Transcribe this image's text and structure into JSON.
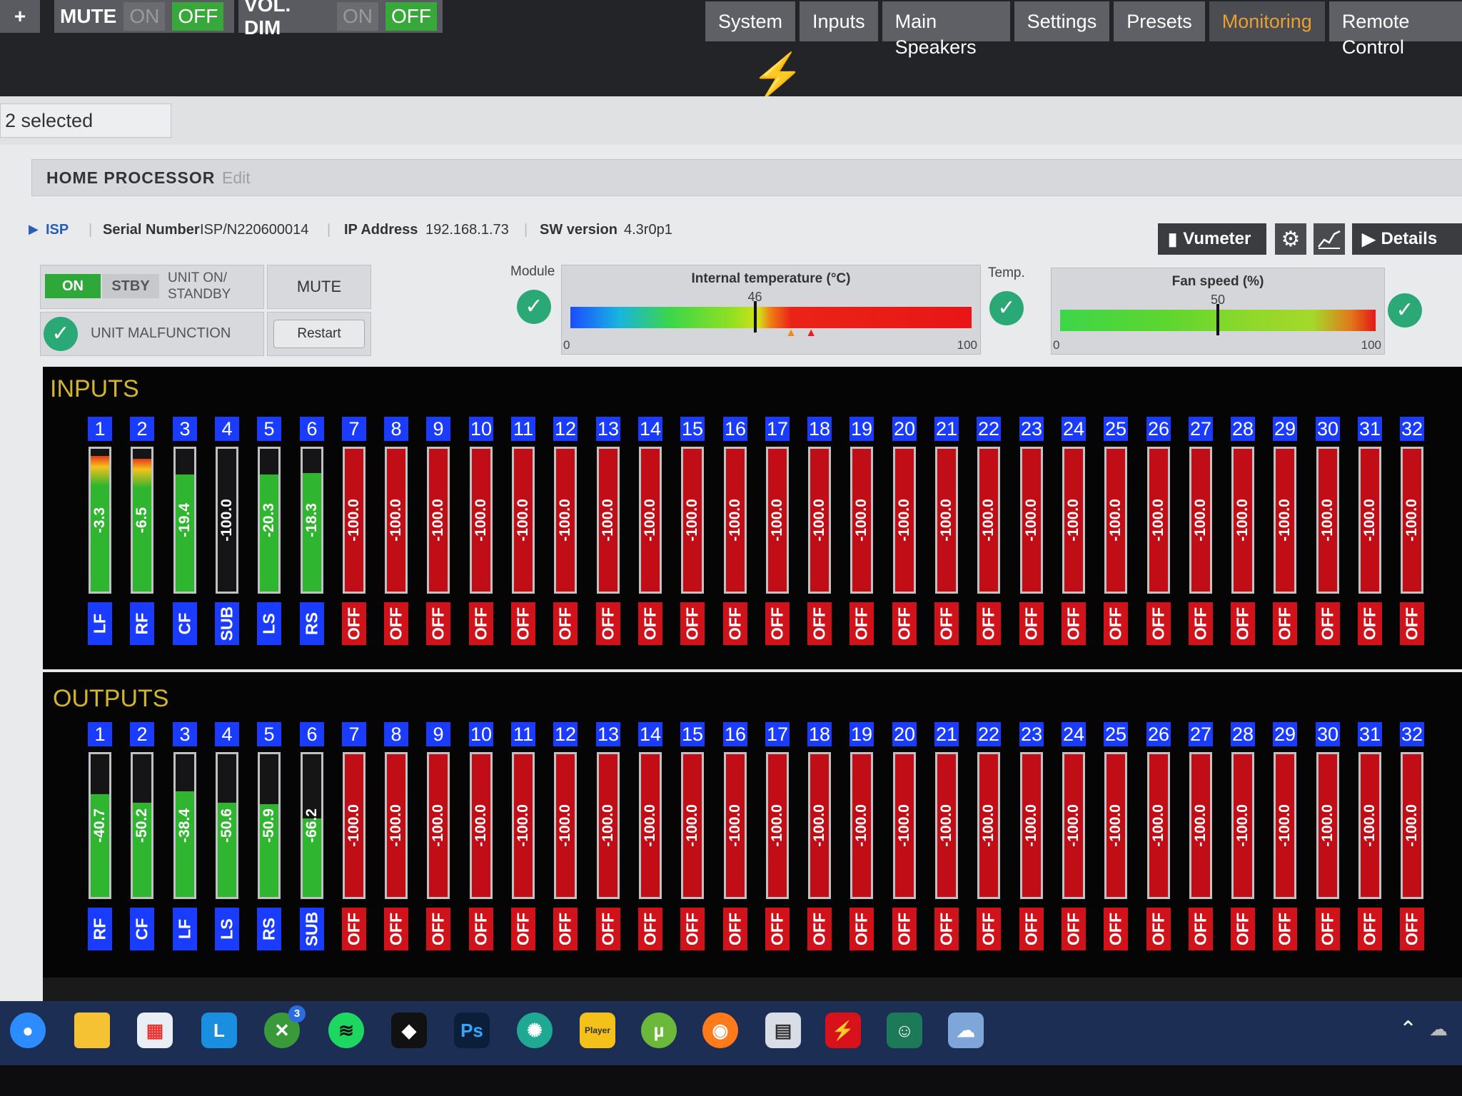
{
  "topbar": {
    "add_label": "+",
    "mute": {
      "label": "MUTE",
      "on": "ON",
      "off": "OFF"
    },
    "voldim": {
      "label": "VOL. DIM",
      "on": "ON",
      "off": "OFF"
    },
    "nav": [
      "System",
      "Inputs",
      "Main Speakers",
      "Settings",
      "Presets",
      "Monitoring",
      "Remote Control"
    ],
    "active_nav": "Monitoring"
  },
  "selected_text": "2 selected",
  "device": {
    "name": "HOME PROCESSOR",
    "edit": "Edit",
    "type": "ISP",
    "serial_label": "Serial Number",
    "serial": "ISP/N220600014",
    "ip_label": "IP Address",
    "ip": "192.168.1.73",
    "sw_label": "SW version",
    "sw": "4.3r0p1",
    "vumeter_label": "Vumeter",
    "details_label": "Details"
  },
  "controls": {
    "on": "ON",
    "stby": "STBY",
    "unit_on_standby": "UNIT ON/ STANDBY",
    "mute": "MUTE",
    "unit_malfunction": "UNIT MALFUNCTION",
    "restart": "Restart",
    "module_label": "Module",
    "temp_label": "Temp."
  },
  "temperature": {
    "title": "Internal temperature (°C)",
    "value": 46,
    "min": 0,
    "max": 100,
    "warn": 55,
    "crit": 60
  },
  "fan": {
    "title": "Fan speed (%)",
    "value": 50,
    "min": 0,
    "max": 100
  },
  "inputs": {
    "title": "INPUTS",
    "channels": [
      {
        "n": "1",
        "v": "-3.3",
        "lvl": 0.95,
        "c": "green",
        "tag": "LF",
        "tc": "blue"
      },
      {
        "n": "2",
        "v": "-6.5",
        "lvl": 0.93,
        "c": "green",
        "tag": "RF",
        "tc": "blue"
      },
      {
        "n": "3",
        "v": "-19.4",
        "lvl": 0.82,
        "c": "green",
        "tag": "CF",
        "tc": "blue"
      },
      {
        "n": "4",
        "v": "-100.0",
        "lvl": 0.0,
        "c": "gray",
        "tag": "SUB",
        "tc": "blue"
      },
      {
        "n": "5",
        "v": "-20.3",
        "lvl": 0.82,
        "c": "green",
        "tag": "LS",
        "tc": "blue"
      },
      {
        "n": "6",
        "v": "-18.3",
        "lvl": 0.83,
        "c": "green",
        "tag": "RS",
        "tc": "blue"
      },
      {
        "n": "7",
        "v": "-100.0",
        "lvl": 1,
        "c": "red",
        "tag": "OFF",
        "tc": "red"
      },
      {
        "n": "8",
        "v": "-100.0",
        "lvl": 1,
        "c": "red",
        "tag": "OFF",
        "tc": "red"
      },
      {
        "n": "9",
        "v": "-100.0",
        "lvl": 1,
        "c": "red",
        "tag": "OFF",
        "tc": "red"
      },
      {
        "n": "10",
        "v": "-100.0",
        "lvl": 1,
        "c": "red",
        "tag": "OFF",
        "tc": "red"
      },
      {
        "n": "11",
        "v": "-100.0",
        "lvl": 1,
        "c": "red",
        "tag": "OFF",
        "tc": "red"
      },
      {
        "n": "12",
        "v": "-100.0",
        "lvl": 1,
        "c": "red",
        "tag": "OFF",
        "tc": "red"
      },
      {
        "n": "13",
        "v": "-100.0",
        "lvl": 1,
        "c": "red",
        "tag": "OFF",
        "tc": "red"
      },
      {
        "n": "14",
        "v": "-100.0",
        "lvl": 1,
        "c": "red",
        "tag": "OFF",
        "tc": "red"
      },
      {
        "n": "15",
        "v": "-100.0",
        "lvl": 1,
        "c": "red",
        "tag": "OFF",
        "tc": "red"
      },
      {
        "n": "16",
        "v": "-100.0",
        "lvl": 1,
        "c": "red",
        "tag": "OFF",
        "tc": "red"
      },
      {
        "n": "17",
        "v": "-100.0",
        "lvl": 1,
        "c": "red",
        "tag": "OFF",
        "tc": "red"
      },
      {
        "n": "18",
        "v": "-100.0",
        "lvl": 1,
        "c": "red",
        "tag": "OFF",
        "tc": "red"
      },
      {
        "n": "19",
        "v": "-100.0",
        "lvl": 1,
        "c": "red",
        "tag": "OFF",
        "tc": "red"
      },
      {
        "n": "20",
        "v": "-100.0",
        "lvl": 1,
        "c": "red",
        "tag": "OFF",
        "tc": "red"
      },
      {
        "n": "21",
        "v": "-100.0",
        "lvl": 1,
        "c": "red",
        "tag": "OFF",
        "tc": "red"
      },
      {
        "n": "22",
        "v": "-100.0",
        "lvl": 1,
        "c": "red",
        "tag": "OFF",
        "tc": "red"
      },
      {
        "n": "23",
        "v": "-100.0",
        "lvl": 1,
        "c": "red",
        "tag": "OFF",
        "tc": "red"
      },
      {
        "n": "24",
        "v": "-100.0",
        "lvl": 1,
        "c": "red",
        "tag": "OFF",
        "tc": "red"
      },
      {
        "n": "25",
        "v": "-100.0",
        "lvl": 1,
        "c": "red",
        "tag": "OFF",
        "tc": "red"
      },
      {
        "n": "26",
        "v": "-100.0",
        "lvl": 1,
        "c": "red",
        "tag": "OFF",
        "tc": "red"
      },
      {
        "n": "27",
        "v": "-100.0",
        "lvl": 1,
        "c": "red",
        "tag": "OFF",
        "tc": "red"
      },
      {
        "n": "28",
        "v": "-100.0",
        "lvl": 1,
        "c": "red",
        "tag": "OFF",
        "tc": "red"
      },
      {
        "n": "29",
        "v": "-100.0",
        "lvl": 1,
        "c": "red",
        "tag": "OFF",
        "tc": "red"
      },
      {
        "n": "30",
        "v": "-100.0",
        "lvl": 1,
        "c": "red",
        "tag": "OFF",
        "tc": "red"
      },
      {
        "n": "31",
        "v": "-100.0",
        "lvl": 1,
        "c": "red",
        "tag": "OFF",
        "tc": "red"
      },
      {
        "n": "32",
        "v": "-100.0",
        "lvl": 1,
        "c": "red",
        "tag": "OFF",
        "tc": "red"
      }
    ]
  },
  "outputs": {
    "title": "OUTPUTS",
    "channels": [
      {
        "n": "1",
        "v": "-40.7",
        "lvl": 0.72,
        "c": "green",
        "tag": "RF",
        "tc": "blue"
      },
      {
        "n": "2",
        "v": "-50.2",
        "lvl": 0.66,
        "c": "green",
        "tag": "CF",
        "tc": "blue"
      },
      {
        "n": "3",
        "v": "-38.4",
        "lvl": 0.74,
        "c": "green",
        "tag": "LF",
        "tc": "blue"
      },
      {
        "n": "4",
        "v": "-50.6",
        "lvl": 0.66,
        "c": "green",
        "tag": "LS",
        "tc": "blue"
      },
      {
        "n": "5",
        "v": "-50.9",
        "lvl": 0.65,
        "c": "green",
        "tag": "RS",
        "tc": "blue"
      },
      {
        "n": "6",
        "v": "-66.2",
        "lvl": 0.55,
        "c": "green",
        "tag": "SUB",
        "tc": "blue"
      },
      {
        "n": "7",
        "v": "-100.0",
        "lvl": 1,
        "c": "red",
        "tag": "OFF",
        "tc": "red"
      },
      {
        "n": "8",
        "v": "-100.0",
        "lvl": 1,
        "c": "red",
        "tag": "OFF",
        "tc": "red"
      },
      {
        "n": "9",
        "v": "-100.0",
        "lvl": 1,
        "c": "red",
        "tag": "OFF",
        "tc": "red"
      },
      {
        "n": "10",
        "v": "-100.0",
        "lvl": 1,
        "c": "red",
        "tag": "OFF",
        "tc": "red"
      },
      {
        "n": "11",
        "v": "-100.0",
        "lvl": 1,
        "c": "red",
        "tag": "OFF",
        "tc": "red"
      },
      {
        "n": "12",
        "v": "-100.0",
        "lvl": 1,
        "c": "red",
        "tag": "OFF",
        "tc": "red"
      },
      {
        "n": "13",
        "v": "-100.0",
        "lvl": 1,
        "c": "red",
        "tag": "OFF",
        "tc": "red"
      },
      {
        "n": "14",
        "v": "-100.0",
        "lvl": 1,
        "c": "red",
        "tag": "OFF",
        "tc": "red"
      },
      {
        "n": "15",
        "v": "-100.0",
        "lvl": 1,
        "c": "red",
        "tag": "OFF",
        "tc": "red"
      },
      {
        "n": "16",
        "v": "-100.0",
        "lvl": 1,
        "c": "red",
        "tag": "OFF",
        "tc": "red"
      },
      {
        "n": "17",
        "v": "-100.0",
        "lvl": 1,
        "c": "red",
        "tag": "OFF",
        "tc": "red"
      },
      {
        "n": "18",
        "v": "-100.0",
        "lvl": 1,
        "c": "red",
        "tag": "OFF",
        "tc": "red"
      },
      {
        "n": "19",
        "v": "-100.0",
        "lvl": 1,
        "c": "red",
        "tag": "OFF",
        "tc": "red"
      },
      {
        "n": "20",
        "v": "-100.0",
        "lvl": 1,
        "c": "red",
        "tag": "OFF",
        "tc": "red"
      },
      {
        "n": "21",
        "v": "-100.0",
        "lvl": 1,
        "c": "red",
        "tag": "OFF",
        "tc": "red"
      },
      {
        "n": "22",
        "v": "-100.0",
        "lvl": 1,
        "c": "red",
        "tag": "OFF",
        "tc": "red"
      },
      {
        "n": "23",
        "v": "-100.0",
        "lvl": 1,
        "c": "red",
        "tag": "OFF",
        "tc": "red"
      },
      {
        "n": "24",
        "v": "-100.0",
        "lvl": 1,
        "c": "red",
        "tag": "OFF",
        "tc": "red"
      },
      {
        "n": "25",
        "v": "-100.0",
        "lvl": 1,
        "c": "red",
        "tag": "OFF",
        "tc": "red"
      },
      {
        "n": "26",
        "v": "-100.0",
        "lvl": 1,
        "c": "red",
        "tag": "OFF",
        "tc": "red"
      },
      {
        "n": "27",
        "v": "-100.0",
        "lvl": 1,
        "c": "red",
        "tag": "OFF",
        "tc": "red"
      },
      {
        "n": "28",
        "v": "-100.0",
        "lvl": 1,
        "c": "red",
        "tag": "OFF",
        "tc": "red"
      },
      {
        "n": "29",
        "v": "-100.0",
        "lvl": 1,
        "c": "red",
        "tag": "OFF",
        "tc": "red"
      },
      {
        "n": "30",
        "v": "-100.0",
        "lvl": 1,
        "c": "red",
        "tag": "OFF",
        "tc": "red"
      },
      {
        "n": "31",
        "v": "-100.0",
        "lvl": 1,
        "c": "red",
        "tag": "OFF",
        "tc": "red"
      },
      {
        "n": "32",
        "v": "-100.0",
        "lvl": 1,
        "c": "red",
        "tag": "OFF",
        "tc": "red"
      }
    ]
  },
  "colors": {
    "green": "#2fb52f",
    "red": "#c10e16",
    "gray": "#4a4a4a",
    "blue_tag": "#1a3cff",
    "red_tag": "#d0121a",
    "accent": "#e8a030"
  },
  "taskbar": {
    "icons": [
      "zoom-icon",
      "file-explorer-icon",
      "store-icon",
      "l-app-icon",
      "xbox-icon",
      "spotify-icon",
      "tidal-icon",
      "photoshop-icon",
      "brain-app-icon",
      "player-app-icon",
      "utorrent-icon",
      "firefox-icon",
      "calculator-icon",
      "bolt-app-icon",
      "robot-app-icon",
      "cloud-app-icon"
    ],
    "xbox_badge": "3",
    "ps_label": "Ps",
    "l_label": "L",
    "utorrent_label": "µ",
    "player_label": "Player"
  }
}
